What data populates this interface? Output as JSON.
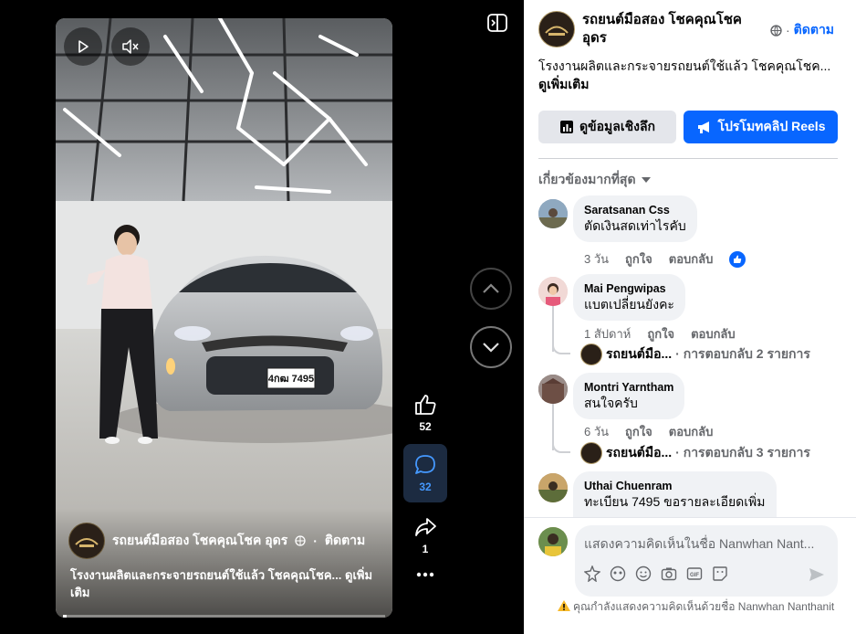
{
  "video": {
    "page_name": "รถยนต์มือสอง โชคคุณโชค อุดร",
    "follow_label": "ติดตาม",
    "description": "โรงงานผลิตและกระจายรถยนต์ใช้แล้ว โชคคุณโชค... ดูเพิ่มเติม",
    "plate_text": "4กฒ 7495",
    "progress_fraction": 0.01
  },
  "actions": {
    "likes": "52",
    "comments": "32",
    "shares": "1"
  },
  "header": {
    "page_name": "รถยนต์มือสอง โชคคุณโชค อุดร",
    "separator": "·",
    "follow_label": "ติดตาม"
  },
  "description": {
    "text": "โรงงานผลิตและกระจายรถยนต์ใช้แล้ว โชคคุณโชค...",
    "see_more": "ดูเพิ่มเติม"
  },
  "buttons": {
    "insights": "ดูข้อมูลเชิงลึก",
    "promote": "โปรโมทคลิป Reels"
  },
  "sort": {
    "label": "เกี่ยวข้องมากที่สุด"
  },
  "comments": [
    {
      "author": "Saratsanan Css",
      "text": "ตัดเงินสดเท่าไรคับ",
      "time": "3 วัน",
      "like": "ถูกใจ",
      "reply": "ตอบกลับ"
    },
    {
      "author": "Mai Pengwipas",
      "text": "แบตเปลี่ยนยังคะ",
      "time": "1 สัปดาห์",
      "like": "ถูกใจ",
      "reply": "ตอบกลับ",
      "replies_by": "รถยนต์มือ...",
      "replies_label": "· การตอบกลับ 2 รายการ"
    },
    {
      "author": "Montri Yarntham",
      "text": "สนใจครับ",
      "time": "6 วัน",
      "like": "ถูกใจ",
      "reply": "ตอบกลับ",
      "replies_by": "รถยนต์มือ...",
      "replies_label": "· การตอบกลับ 3 รายการ"
    },
    {
      "author": "Uthai Chuenram",
      "text": "ทะเบียน 7495 ขอรายละเอียดเพิ่ม"
    }
  ],
  "composer": {
    "placeholder": "แสดงความคิดเห็นในชื่อ Nanwhan Nant...",
    "warning": "คุณกำลังแสดงความคิดเห็นด้วยชื่อ Nanwhan Nanthanit"
  },
  "colors": {
    "accent": "#0866ff",
    "active_action_bg": "#1c2b41"
  }
}
